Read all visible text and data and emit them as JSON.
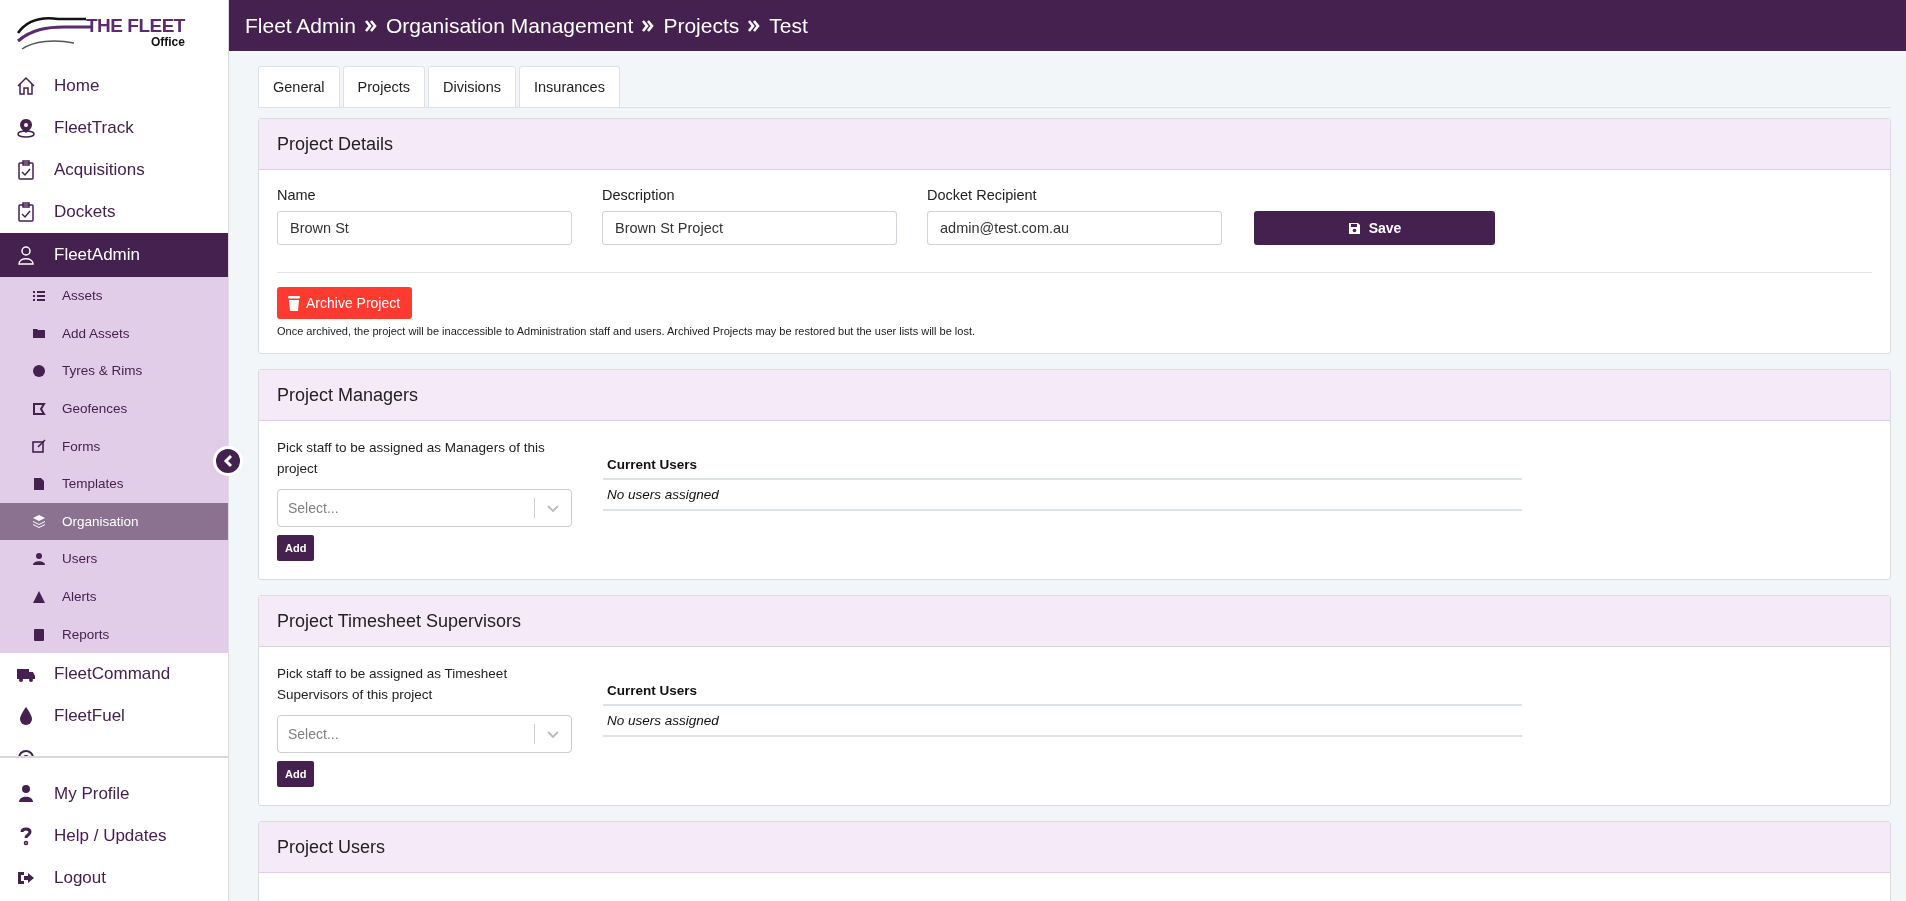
{
  "logo": {
    "title": "THE FLEET",
    "subtitle": "Office"
  },
  "sidebar": {
    "items": [
      {
        "label": "Home",
        "selected": false
      },
      {
        "label": "FleetTrack",
        "selected": false
      },
      {
        "label": "Acquisitions",
        "selected": false
      },
      {
        "label": "Dockets",
        "selected": false
      },
      {
        "label": "FleetAdmin",
        "selected": true,
        "children": [
          {
            "label": "Assets",
            "selected": false
          },
          {
            "label": "Add Assets",
            "selected": false
          },
          {
            "label": "Tyres & Rims",
            "selected": false
          },
          {
            "label": "Geofences",
            "selected": false
          },
          {
            "label": "Forms",
            "selected": false
          },
          {
            "label": "Templates",
            "selected": false
          },
          {
            "label": "Organisation",
            "selected": true
          },
          {
            "label": "Users",
            "selected": false
          },
          {
            "label": "Alerts",
            "selected": false
          },
          {
            "label": "Reports",
            "selected": false
          }
        ]
      },
      {
        "label": "FleetCommand",
        "selected": false
      },
      {
        "label": "FleetFuel",
        "selected": false
      }
    ],
    "footer_items": [
      {
        "label": "My Profile"
      },
      {
        "label": "Help / Updates"
      },
      {
        "label": "Logout"
      }
    ]
  },
  "breadcrumb": [
    "Fleet Admin",
    "Organisation Management",
    "Projects",
    "Test"
  ],
  "tabs": [
    {
      "label": "General"
    },
    {
      "label": "Projects"
    },
    {
      "label": "Divisions"
    },
    {
      "label": "Insurances"
    }
  ],
  "sections": [
    {
      "kind": "details",
      "title": "Project Details",
      "fields": [
        {
          "label": "Name",
          "value": "Brown St"
        },
        {
          "label": "Description",
          "value": "Brown St Project"
        },
        {
          "label": "Docket Recipient",
          "value": "admin@test.com.au"
        }
      ],
      "save_button": "Save",
      "archive_button": "Archive Project",
      "note": "Once archived, the project will be inaccessible to Administration staff and users. Archived Projects may be restored but the user lists will be lost."
    },
    {
      "kind": "assign",
      "title": "Project Managers",
      "prompt": "Pick staff to be assigned as Managers of this project",
      "placeholder": "Select...",
      "add_button": "Add",
      "table_heading": "Current Users",
      "empty_text": "No users assigned"
    },
    {
      "kind": "assign",
      "title": "Project Timesheet Supervisors",
      "prompt": "Pick staff to be assigned as Timesheet Supervisors of this project",
      "placeholder": "Select...",
      "add_button": "Add",
      "table_heading": "Current Users",
      "empty_text": "No users assigned"
    },
    {
      "kind": "header_only",
      "title": "Project Users"
    }
  ]
}
